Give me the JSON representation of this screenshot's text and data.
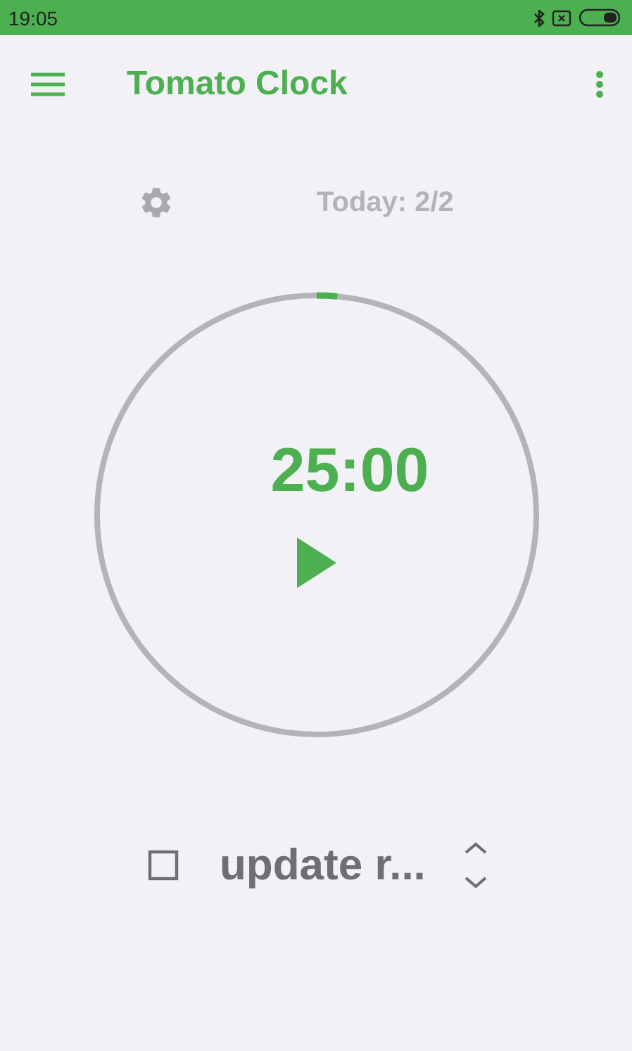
{
  "status_bar": {
    "time": "19:05"
  },
  "app_bar": {
    "title": "Tomato Clock"
  },
  "stats": {
    "today": "Today: 2/2"
  },
  "timer": {
    "time": "25:00",
    "level": 0.015,
    "running": false
  },
  "task": {
    "checked": false,
    "name": "update r..."
  }
}
